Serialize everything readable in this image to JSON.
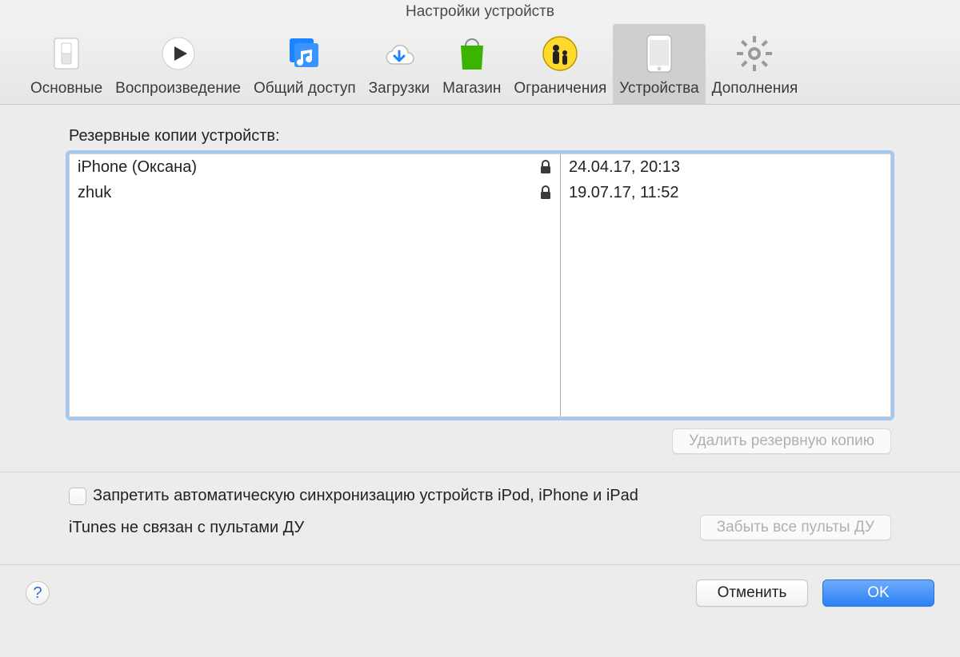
{
  "window": {
    "title": "Настройки устройств"
  },
  "toolbar": {
    "items": [
      {
        "label": "Основные"
      },
      {
        "label": "Воспроизведение"
      },
      {
        "label": "Общий доступ"
      },
      {
        "label": "Загрузки"
      },
      {
        "label": "Магазин"
      },
      {
        "label": "Ограничения"
      },
      {
        "label": "Устройства"
      },
      {
        "label": "Дополнения"
      }
    ],
    "selected_index": 6
  },
  "backups": {
    "section_label": "Резервные копии устройств:",
    "rows": [
      {
        "name": "iPhone (Оксана)",
        "encrypted": true,
        "date": "24.04.17, 20:13"
      },
      {
        "name": "zhuk",
        "encrypted": true,
        "date": "19.07.17, 11:52"
      }
    ],
    "delete_button": "Удалить резервную копию",
    "delete_enabled": false
  },
  "sync": {
    "checkbox_label": "Запретить автоматическую синхронизацию устройств iPod, iPhone и iPad",
    "checked": false
  },
  "remotes": {
    "status_text": "iTunes не связан с пультами ДУ",
    "forget_button": "Забыть все пульты ДУ",
    "forget_enabled": false
  },
  "footer": {
    "cancel": "Отменить",
    "ok": "OK"
  }
}
